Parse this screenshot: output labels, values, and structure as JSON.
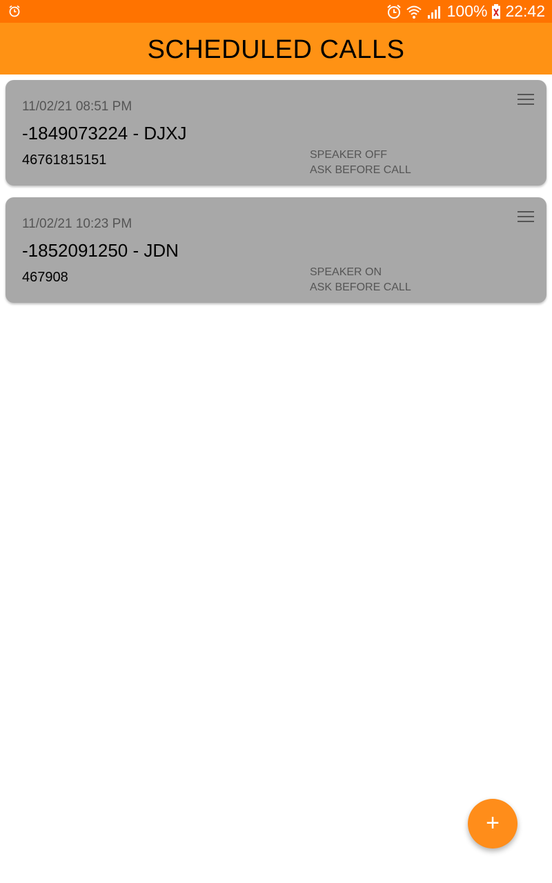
{
  "status_bar": {
    "battery_percent": "100%",
    "time": "22:42",
    "icons": [
      "alarm-icon",
      "alarm-clock-icon",
      "wifi-icon",
      "signal-icon",
      "battery-charging-icon"
    ]
  },
  "app_bar": {
    "title": "SCHEDULED CALLS"
  },
  "calls": [
    {
      "datetime": "11/02/21 08:51 PM",
      "name": "-1849073224 - DJXJ",
      "number": "46761815151",
      "speaker": "SPEAKER OFF",
      "ask": "ASK BEFORE CALL"
    },
    {
      "datetime": "11/02/21 10:23 PM",
      "name": "-1852091250 - JDN",
      "number": "467908",
      "speaker": "SPEAKER ON",
      "ask": "ASK BEFORE CALL"
    }
  ],
  "fab": {
    "label": "+"
  },
  "colors": {
    "status_bar": "#ff7300",
    "app_bar": "#ff9214",
    "card": "#a8a8a8",
    "fab": "#ff8d1a"
  }
}
